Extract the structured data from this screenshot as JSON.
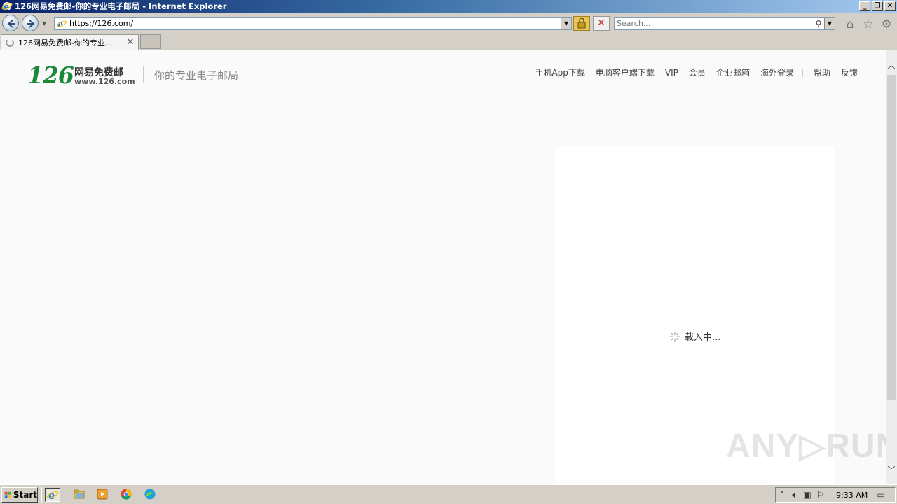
{
  "window": {
    "title": "126网易免费邮-你的专业电子邮局 - Internet Explorer",
    "buttons": {
      "minimize": "_",
      "restore": "❐",
      "close": "✕"
    }
  },
  "address_bar": {
    "url": "https://126.com/",
    "dropdown_glyph": "▼"
  },
  "search": {
    "placeholder": "Search...",
    "dropdown_glyph": "▼"
  },
  "tab": {
    "label": "126网易免费邮-你的专业...",
    "close": "✕"
  },
  "page": {
    "logo_number": "126",
    "logo_name": "网易免费邮",
    "logo_url": "www.126.com",
    "slogan": "你的专业电子邮局",
    "nav": {
      "app_download": "手机App下载",
      "client_download": "电脑客户端下载",
      "vip": "VIP",
      "member": "会员",
      "enterprise": "企业邮箱",
      "overseas": "海外登录",
      "help": "帮助",
      "feedback": "反馈"
    },
    "loading_text": "载入中..."
  },
  "watermark": "ANY▷RUN",
  "taskbar": {
    "start_label": "Start",
    "clock": "9:33 AM"
  },
  "icons": {
    "back": "back-arrow-icon",
    "forward": "forward-arrow-icon",
    "home": "home-icon",
    "favorites": "star-icon",
    "tools": "gear-icon"
  },
  "colors": {
    "brand_green": "#1a8a3a",
    "titlebar_start": "#0a246a",
    "titlebar_end": "#a6caf0"
  }
}
